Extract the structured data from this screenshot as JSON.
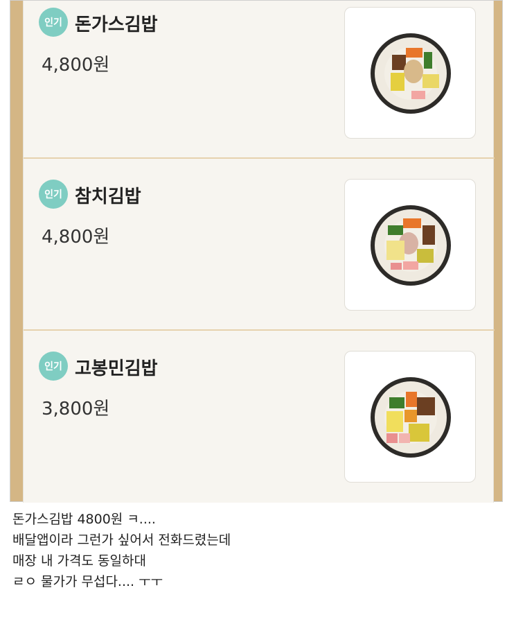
{
  "menu": {
    "items": [
      {
        "badge": "인기",
        "name": "돈가스김밥",
        "price": "4,800원",
        "image_icon": "kimbap-donkatsu-icon"
      },
      {
        "badge": "인기",
        "name": "참치김밥",
        "price": "4,800원",
        "image_icon": "kimbap-tuna-icon"
      },
      {
        "badge": "인기",
        "name": "고봉민김밥",
        "price": "3,800원",
        "image_icon": "kimbap-gobongmin-icon"
      }
    ]
  },
  "post": {
    "lines": [
      "돈가스김밥 4800원 ㅋ....",
      "배달앱이라 그런가 싶어서 전화드렸는데",
      "매장 내 가격도 동일하대",
      "ㄹㅇ 물가가 무섭다.... ㅜㅜ"
    ]
  },
  "colors": {
    "frame_gold": "#d4b685",
    "card_bg": "#f7f5f0",
    "badge_teal": "#7fcdc2",
    "divider": "#e6d2ae"
  }
}
